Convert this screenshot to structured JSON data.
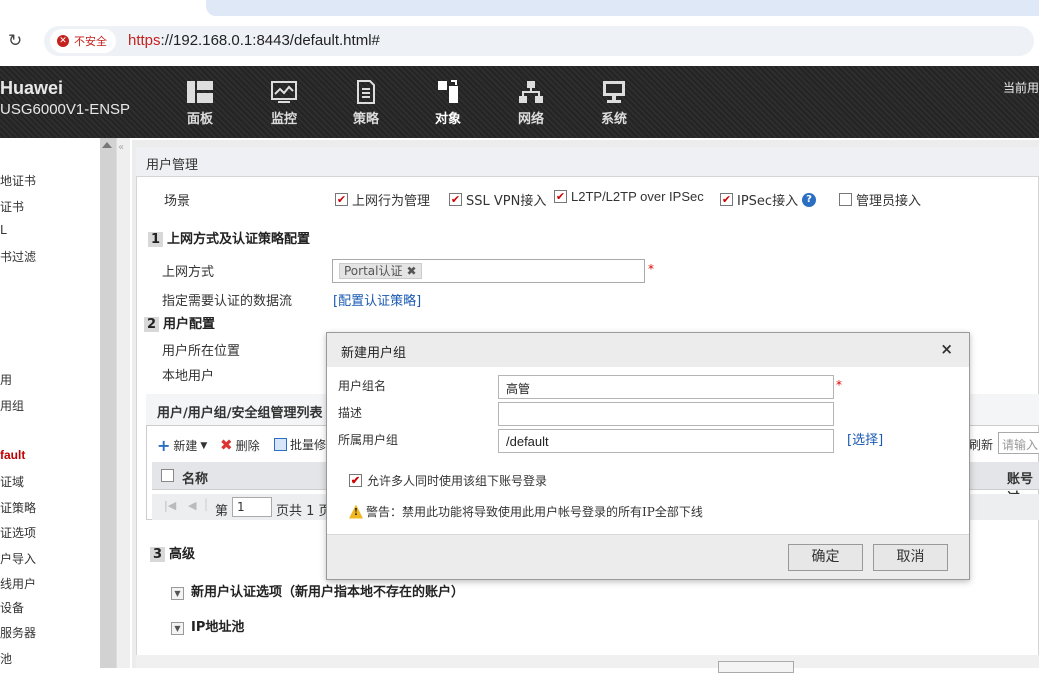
{
  "browser": {
    "security_label": "不安全",
    "url_scheme": "https",
    "url_rest": "://192.168.0.1:8443/default.html#"
  },
  "header": {
    "brand_line1": "Huawei",
    "brand_line2": "USG6000V1-ENSP",
    "nav": [
      {
        "label": "面板",
        "icon": "dashboard-icon"
      },
      {
        "label": "监控",
        "icon": "monitor-chart-icon"
      },
      {
        "label": "策略",
        "icon": "policy-doc-icon"
      },
      {
        "label": "对象",
        "icon": "object-icon"
      },
      {
        "label": "网络",
        "icon": "network-icon"
      },
      {
        "label": "系统",
        "icon": "system-icon"
      }
    ],
    "active_nav": "对象",
    "current_user_label": "当前用"
  },
  "sidebar": {
    "items": [
      "地证书",
      "证书",
      "L",
      "书过滤",
      "用",
      "用组",
      "fault",
      "证域",
      "证策略",
      "证选项",
      "户导入",
      "线用户",
      "设备",
      "服务器",
      "池"
    ],
    "active_item": "fault"
  },
  "page": {
    "title": "用户管理",
    "scene_label": "场景",
    "scene_options": [
      {
        "label": "上网行为管理",
        "checked": true
      },
      {
        "label": "SSL VPN接入",
        "checked": true
      },
      {
        "label": "L2TP/L2TP over IPSec",
        "checked": true
      },
      {
        "label": "IPSec接入",
        "checked": true
      },
      {
        "label": "管理员接入",
        "checked": false
      }
    ],
    "section1": {
      "num": "1",
      "title": "上网方式及认证策略配置"
    },
    "access_label": "上网方式",
    "access_tag": "Portal认证",
    "auth_flow_label": "指定需要认证的数据流",
    "auth_flow_link": "[配置认证策略]",
    "section2": {
      "num": "2",
      "title": "用户配置"
    },
    "user_location_label": "用户所在位置",
    "local_user_label": "本地用户",
    "list_title": "用户/用户组/安全组管理列表",
    "toolbar": {
      "new": "新建",
      "delete": "删除",
      "batch": "批量修"
    },
    "refresh": "刷新",
    "search_placeholder": "请输入",
    "col_name": "名称",
    "col_account": "账号过",
    "pager_prefix": "第",
    "pager_value": "1",
    "pager_suffix": "页共 1 页",
    "section3": {
      "num": "3",
      "title": "高级"
    },
    "advanced1": "新用户认证选项（新用户指本地不存在的账户）",
    "advanced2": "IP地址池"
  },
  "dialog": {
    "title": "新建用户组",
    "name_label": "用户组名",
    "name_value": "高管",
    "desc_label": "描述",
    "desc_value": "",
    "parent_label": "所属用户组",
    "parent_value": "/default",
    "select_link": "[选择]",
    "multi_login_label": "允许多人同时使用该组下账号登录",
    "multi_login_checked": true,
    "warning": "警告：禁用此功能将导致使用此用户帐号登录的所有IP全部下线",
    "ok": "确定",
    "cancel": "取消"
  }
}
